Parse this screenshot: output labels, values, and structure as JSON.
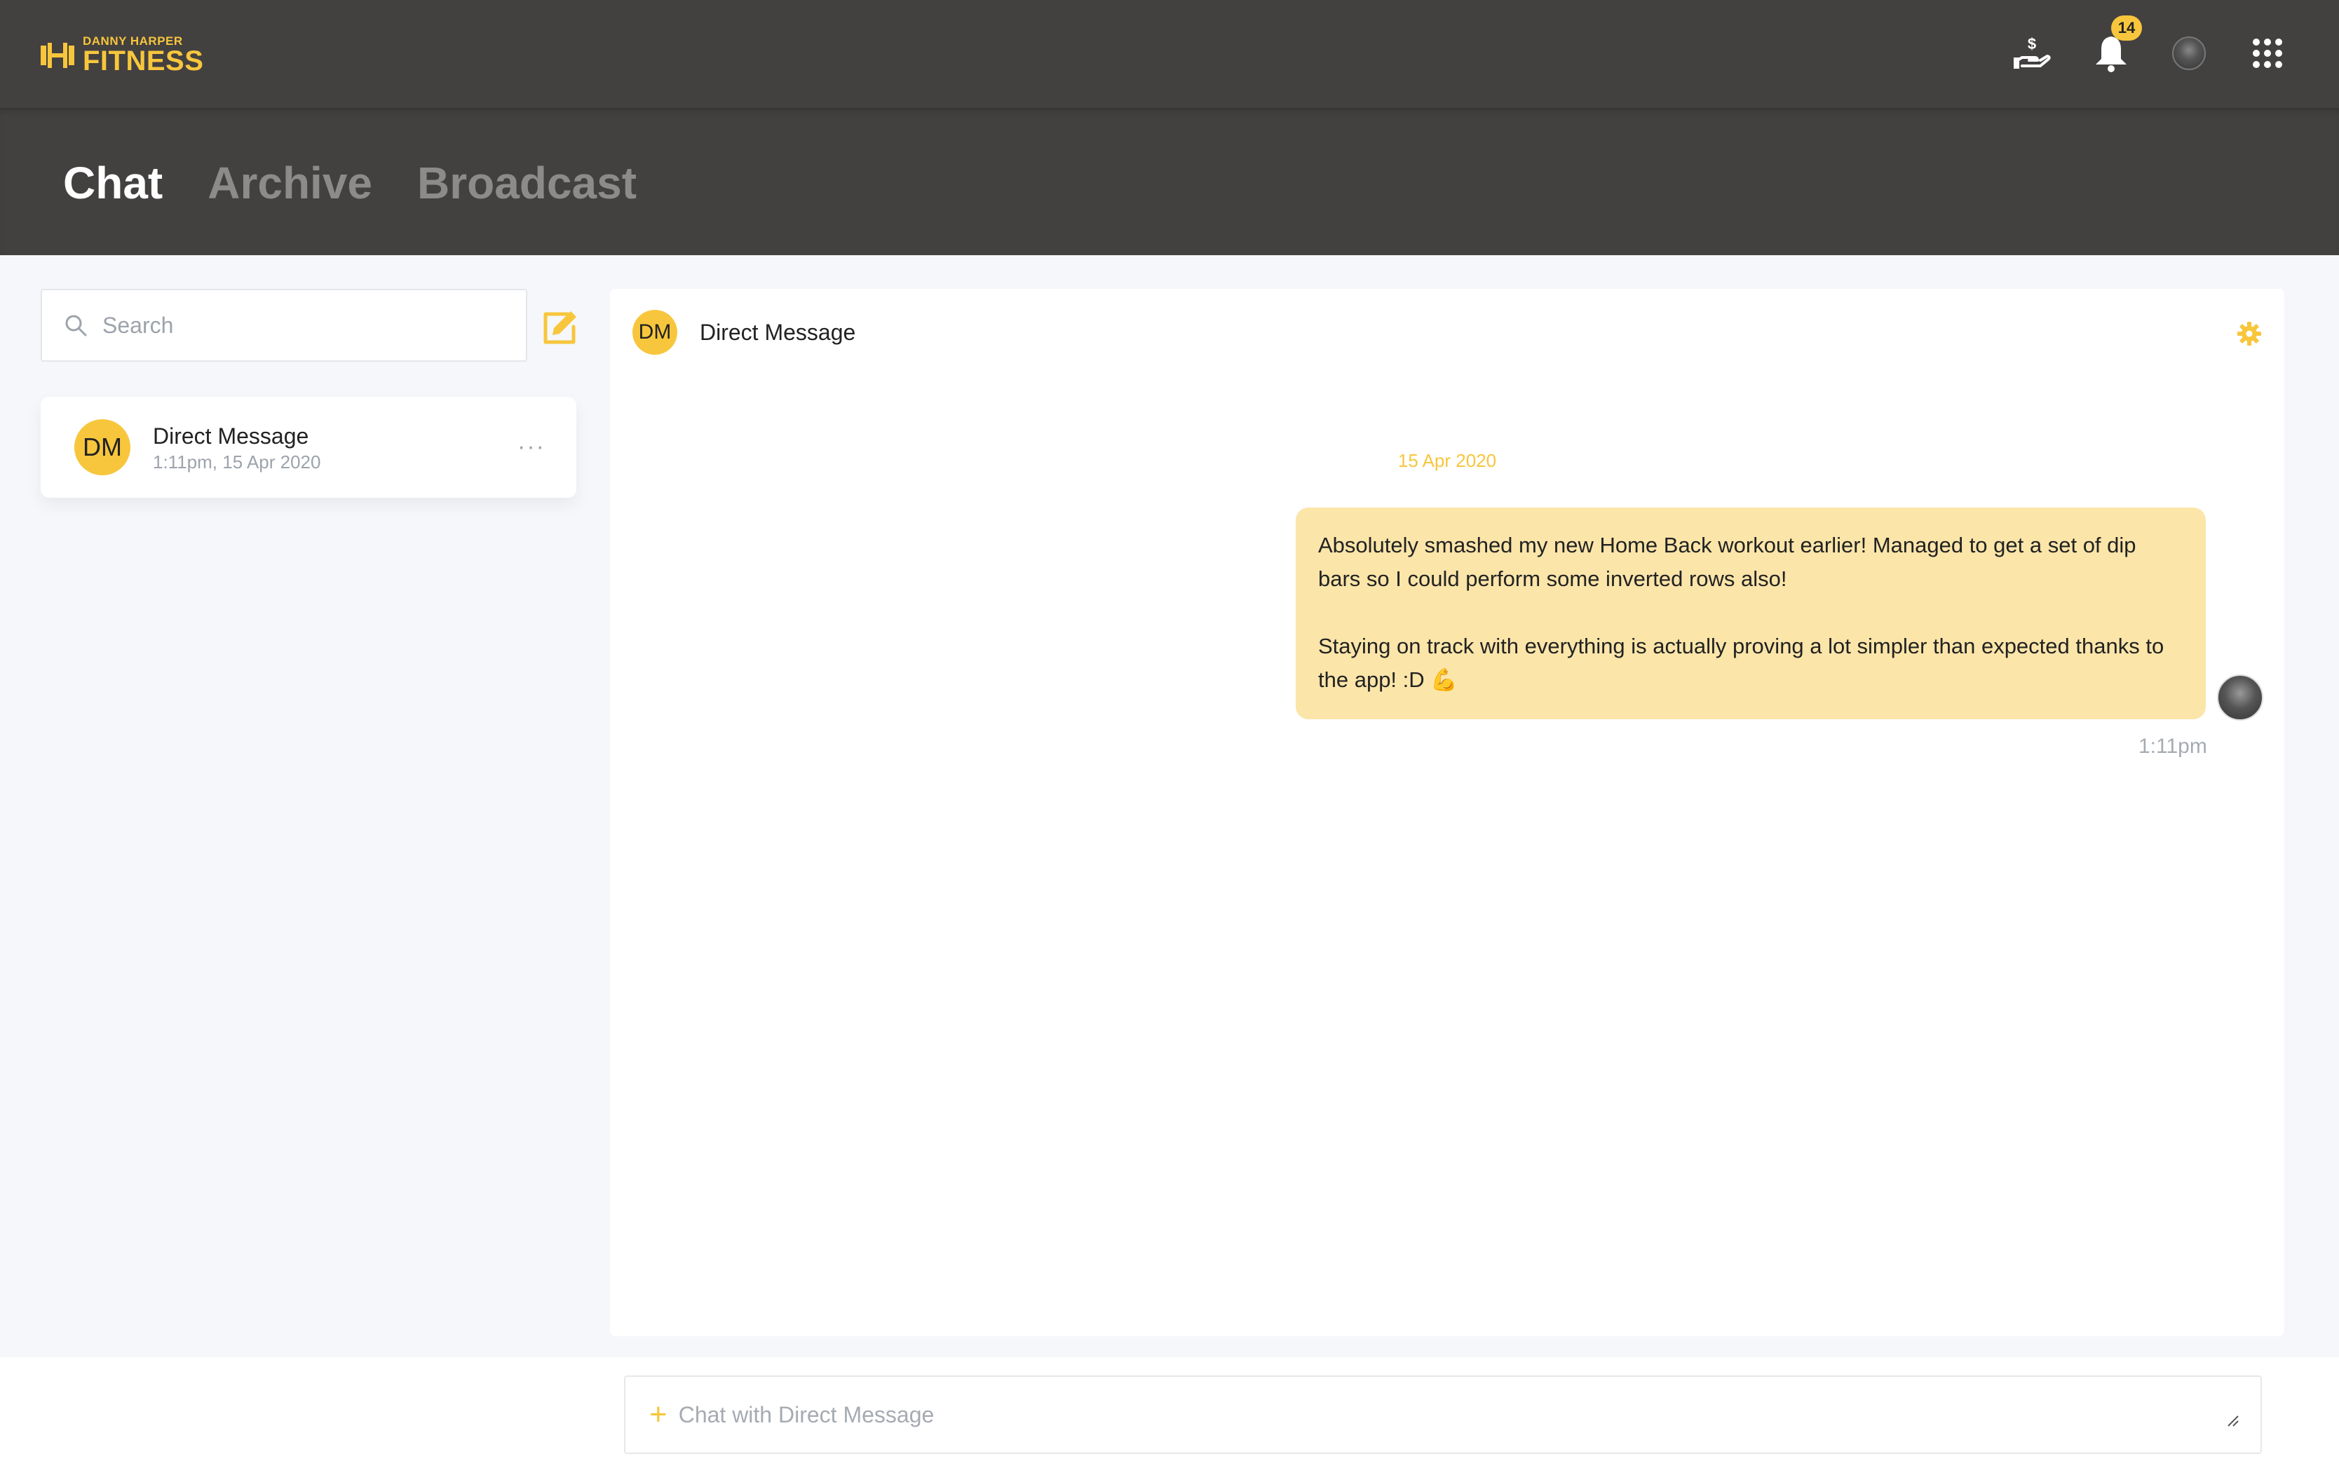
{
  "brand": {
    "top": "DANNY HARPER",
    "main": "FITNESS",
    "accent": "#f7c63c"
  },
  "header": {
    "notification_count": "14"
  },
  "tabs": [
    {
      "label": "Chat",
      "active": true
    },
    {
      "label": "Archive",
      "active": false
    },
    {
      "label": "Broadcast",
      "active": false
    }
  ],
  "sidebar": {
    "search_placeholder": "Search",
    "conversation": {
      "initials": "DM",
      "name": "Direct Message",
      "time": "1:11pm, 15 Apr 2020",
      "more": "···"
    }
  },
  "chat": {
    "initials": "DM",
    "title": "Direct Message",
    "date_separator": "15 Apr 2020",
    "message": {
      "paragraph1": "Absolutely smashed my new Home Back workout earlier! Managed to get a set of dip bars so I could perform some inverted rows also!",
      "paragraph2": "Staying on track with everything is actually proving a lot simpler than expected thanks to the app! :D 💪",
      "time": "1:11pm"
    }
  },
  "composer": {
    "placeholder": "Chat with Direct Message",
    "plus": "+"
  },
  "colors": {
    "topbar": "#434040",
    "bubble": "#fbe5a9",
    "accent": "#f7c63c"
  }
}
